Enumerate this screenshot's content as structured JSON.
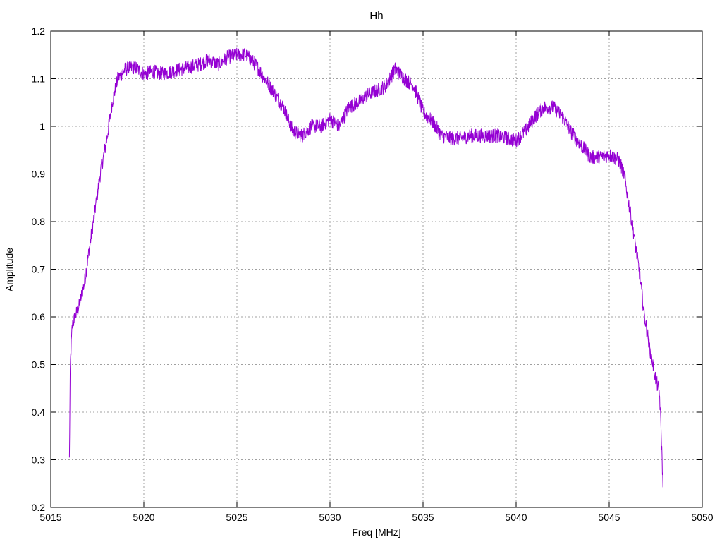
{
  "chart_data": {
    "type": "line",
    "title": "Hh",
    "xlabel": "Freq [MHz]",
    "ylabel": "Amplitude",
    "xlim": [
      5015,
      5050
    ],
    "ylim": [
      0.2,
      1.2
    ],
    "xticks": [
      5015,
      5020,
      5025,
      5030,
      5035,
      5040,
      5045,
      5050
    ],
    "yticks": [
      0.2,
      0.3,
      0.4,
      0.5,
      0.6,
      0.7,
      0.8,
      0.9,
      1,
      1.1,
      1.2
    ],
    "xtick_labels": [
      "5015",
      "5020",
      "5025",
      "5030",
      "5035",
      "5040",
      "5045",
      "5050"
    ],
    "ytick_labels": [
      "0.2",
      "0.3",
      "0.4",
      "0.5",
      "0.6",
      "0.7",
      "0.8",
      "0.9",
      "1",
      "1.1",
      "1.2"
    ],
    "grid": true,
    "legend": "none",
    "series": [
      {
        "color": "#9400d3",
        "noise_amplitude": 0.015,
        "x": [
          5016.0,
          5016.05,
          5016.15,
          5016.3,
          5016.5,
          5016.8,
          5017.1,
          5017.4,
          5017.7,
          5018.0,
          5018.3,
          5018.6,
          5019.0,
          5019.5,
          5020.0,
          5020.5,
          5021.0,
          5021.5,
          5022.0,
          5022.5,
          5023.0,
          5023.5,
          5024.0,
          5024.5,
          5025.0,
          5025.5,
          5026.0,
          5026.5,
          5027.0,
          5027.5,
          5028.0,
          5028.5,
          5029.0,
          5029.5,
          5030.0,
          5030.5,
          5031.0,
          5031.5,
          5032.0,
          5032.5,
          5033.0,
          5033.5,
          5034.0,
          5034.5,
          5035.0,
          5035.5,
          5036.0,
          5036.5,
          5037.0,
          5037.5,
          5038.0,
          5038.5,
          5039.0,
          5039.5,
          5040.0,
          5040.5,
          5041.0,
          5041.5,
          5042.0,
          5042.5,
          5043.0,
          5043.5,
          5044.0,
          5044.5,
          5045.0,
          5045.5,
          5045.8,
          5046.0,
          5046.3,
          5046.6,
          5046.9,
          5047.2,
          5047.5,
          5047.7,
          5047.8,
          5047.9
        ],
        "y": [
          0.3,
          0.5,
          0.58,
          0.6,
          0.62,
          0.67,
          0.75,
          0.83,
          0.91,
          0.97,
          1.05,
          1.1,
          1.12,
          1.125,
          1.11,
          1.115,
          1.11,
          1.115,
          1.12,
          1.125,
          1.13,
          1.14,
          1.13,
          1.145,
          1.15,
          1.15,
          1.13,
          1.1,
          1.07,
          1.04,
          0.99,
          0.98,
          1.0,
          1.0,
          1.015,
          1.0,
          1.04,
          1.05,
          1.065,
          1.075,
          1.085,
          1.12,
          1.1,
          1.085,
          1.03,
          1.01,
          0.98,
          0.975,
          0.975,
          0.98,
          0.98,
          0.98,
          0.98,
          0.975,
          0.97,
          0.99,
          1.02,
          1.04,
          1.04,
          1.02,
          0.985,
          0.96,
          0.935,
          0.935,
          0.94,
          0.93,
          0.9,
          0.85,
          0.78,
          0.7,
          0.6,
          0.53,
          0.47,
          0.44,
          0.35,
          0.23
        ]
      }
    ]
  }
}
